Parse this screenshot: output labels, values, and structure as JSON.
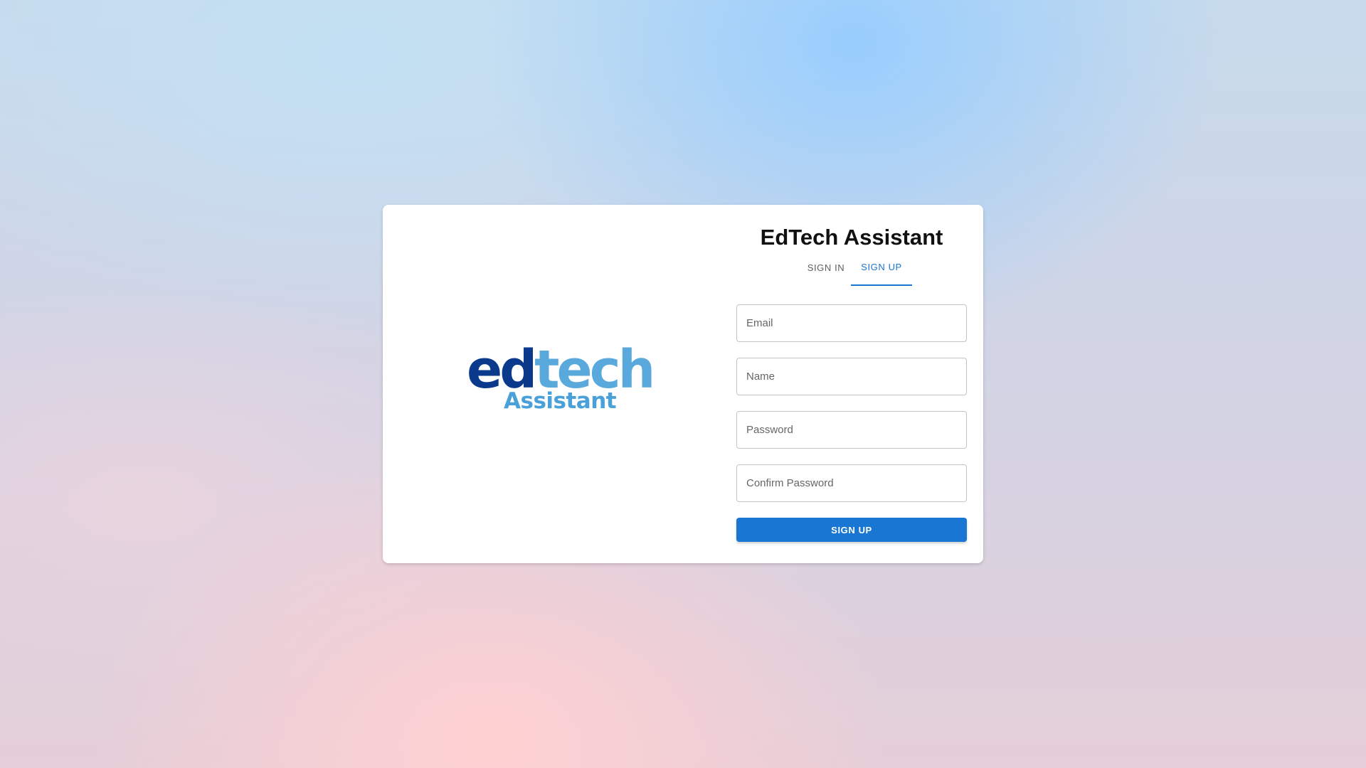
{
  "app": {
    "title": "EdTech Assistant"
  },
  "logo": {
    "word_part1": "ed",
    "word_part2": "tech",
    "subtitle": "Assistant",
    "colors": {
      "primary": "#0b3a8c",
      "secondary": "#5aa9dc"
    }
  },
  "tabs": [
    {
      "label": "SIGN IN",
      "active": false
    },
    {
      "label": "SIGN UP",
      "active": true
    }
  ],
  "form": {
    "fields": [
      {
        "placeholder": "Email",
        "value": ""
      },
      {
        "placeholder": "Name",
        "value": ""
      },
      {
        "placeholder": "Password",
        "value": ""
      },
      {
        "placeholder": "Confirm Password",
        "value": ""
      }
    ],
    "submit_label": "SIGN UP"
  },
  "colors": {
    "accent": "#1976d2",
    "card_background": "#ffffff"
  }
}
